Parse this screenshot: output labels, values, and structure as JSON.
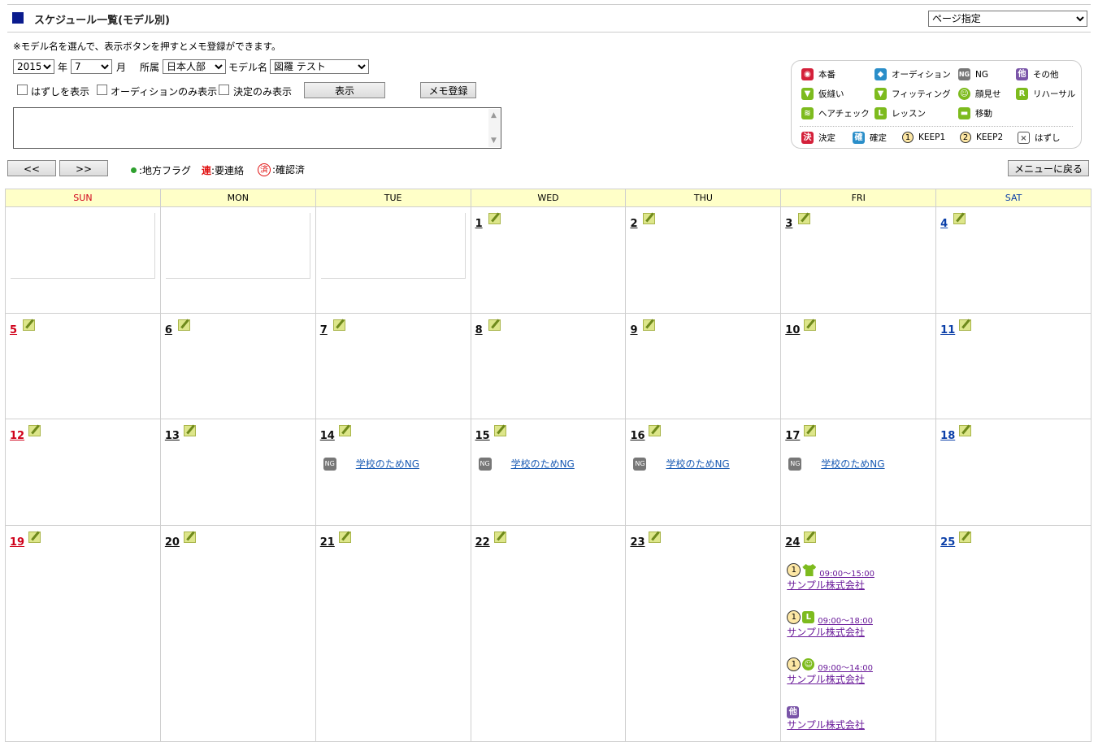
{
  "header": {
    "title": "スケジュール一覧(モデル別)",
    "page_select": "ページ指定"
  },
  "note": "※モデル名を選んで、表示ボタンを押すとメモ登録ができます。",
  "filters": {
    "year": "2015",
    "year_unit": "年",
    "month": "7",
    "month_unit": "月",
    "office_label": "所属",
    "office": "日本人部",
    "model_label": "モデル名",
    "model": "図羅 テスト",
    "cb_hazushi": "はずしを表示",
    "cb_audition": "オーディションのみ表示",
    "cb_kettei": "決定のみ表示",
    "show_button": "表示",
    "memo_button": "メモ登録"
  },
  "legend": {
    "honban": "本番",
    "audition": "オーディション",
    "ng": "NG",
    "other": "その他",
    "karinui": "仮縫い",
    "fitting": "フィッティング",
    "kaomise": "顔見せ",
    "rehearsal": "リハーサル",
    "haircheck": "ヘアチェック",
    "lesson": "レッスン",
    "idou": "移動",
    "kettei": "決定",
    "kakutei": "確定",
    "keep1": "KEEP1",
    "keep2": "KEEP2",
    "hazushi": "はずし",
    "icon_ng": "NG",
    "icon_other": "他",
    "icon_rehearsal": "R",
    "icon_lesson": "L",
    "icon_kettei": "決",
    "icon_kakutei": "確",
    "icon_keep1": "1",
    "icon_keep2": "2",
    "icon_hazushi": "×"
  },
  "nav": {
    "prev": "<<",
    "next": ">>",
    "hint_region": ":地方フラグ",
    "hint_contact_mark": "連",
    "hint_contact": ":要連絡",
    "hint_confirm_mark": "済",
    "hint_confirm": ":確認済",
    "menu_back": "メニューに戻る"
  },
  "weekdays": [
    "SUN",
    "MON",
    "TUE",
    "WED",
    "THU",
    "FRI",
    "SAT"
  ],
  "ng_text": "学校のためNG",
  "ng_badge": "NG",
  "events_24": [
    {
      "keep": "1",
      "icon": "shirt",
      "time": "09:00～15:00",
      "company": "サンプル株式会社"
    },
    {
      "keep": "1",
      "icon": "lesson",
      "time": "09:00～18:00",
      "company": "サンプル株式会社"
    },
    {
      "keep": "1",
      "icon": "smile",
      "time": "09:00～14:00",
      "company": "サンプル株式会社"
    },
    {
      "keep": "",
      "icon": "other",
      "time": "",
      "company": "サンプル株式会社"
    }
  ],
  "weeks": [
    [
      "",
      "",
      "",
      "1",
      "2",
      "3",
      "4"
    ],
    [
      "5",
      "6",
      "7",
      "8",
      "9",
      "10",
      "11"
    ],
    [
      "12",
      "13",
      "14",
      "15",
      "16",
      "17",
      "18"
    ],
    [
      "19",
      "20",
      "21",
      "22",
      "23",
      "24",
      "25"
    ]
  ],
  "colors": {
    "accent": "#0a1b8e",
    "header_bg": "#ffffc8",
    "sunday": "#d0021b",
    "saturday": "#0b3fa8",
    "link": "#1a5bb4",
    "event": "#6a1b9a"
  }
}
